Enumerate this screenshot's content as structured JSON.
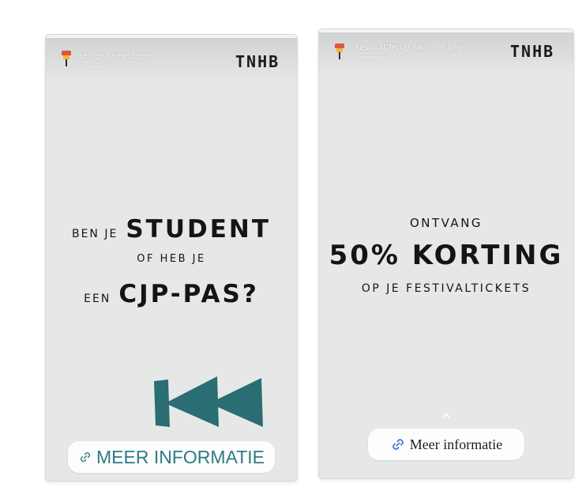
{
  "stories": [
    {
      "account": {
        "name": "terugnaarhetbegin",
        "subtitle": "Gesponsord"
      },
      "brand": "TNHB",
      "progress": 1.0,
      "headline": {
        "line1_small": "BEN JE",
        "line1_big": "STUDENT",
        "line2": "OF HEB JE",
        "line3_small": "EEN",
        "line3_big": "CJP-PAS?"
      },
      "link_label": "MEER INFORMATIE",
      "colors": {
        "accent": "#2a6d73",
        "background": "#e6e8e7"
      },
      "icons": {
        "avatar": "tnhb-flag-logo",
        "graphic": "rewind-icon",
        "link": "link-icon"
      }
    },
    {
      "account": {
        "name": "Festival Terug naar het begin",
        "subtitle": "Gesponsord"
      },
      "brand": "TNHB",
      "progress": 1.0,
      "headline": {
        "line1": "ONTVANG",
        "line2": "50% KORTING",
        "line3": "OP JE FESTIVALTICKETS"
      },
      "link_label": "Meer informatie",
      "colors": {
        "link_icon": "#3a7bd5",
        "background": "#e6e8e7"
      },
      "icons": {
        "avatar": "tnhb-flag-logo",
        "swipe_up": "chevron-up-icon",
        "link": "link-icon"
      }
    }
  ]
}
